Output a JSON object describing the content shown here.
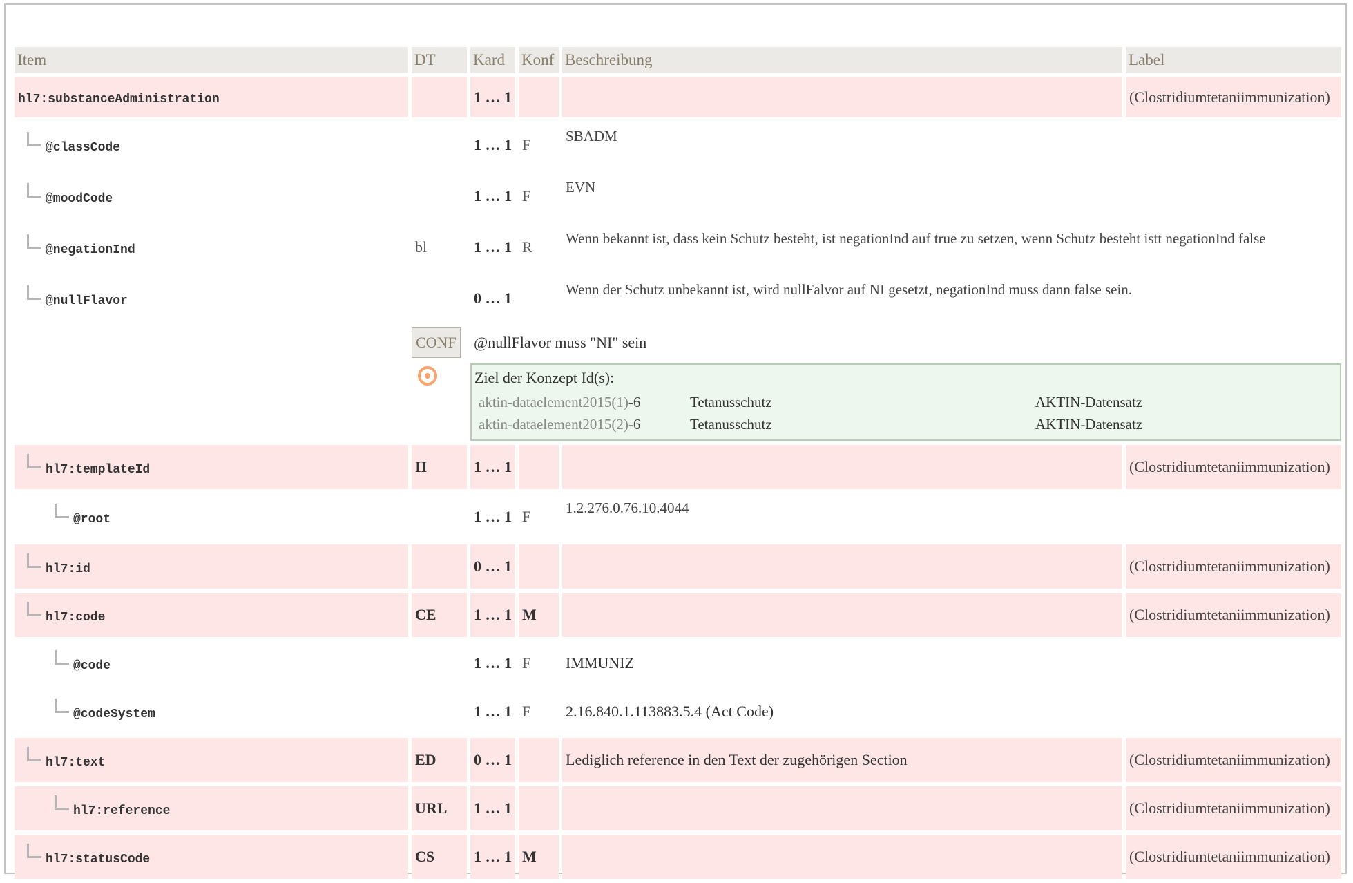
{
  "headers": {
    "item": "Item",
    "dt": "DT",
    "kard": "Kard",
    "konf": "Konf",
    "beschreibung": "Beschreibung",
    "label": "Label"
  },
  "rows": [
    {
      "item": "hl7:substanceAdministration",
      "dt": "",
      "kard": "1 … 1",
      "konf": "",
      "desc": "",
      "label": "(Clostridiumtetaniimmunization)"
    },
    {
      "item": "@classCode",
      "dt": "",
      "kard": "1 … 1",
      "konf": "F",
      "desc": "SBADM",
      "label": ""
    },
    {
      "item": "@moodCode",
      "dt": "",
      "kard": "1 … 1",
      "konf": "F",
      "desc": "EVN",
      "label": ""
    },
    {
      "item": "@negationInd",
      "dt": "bl",
      "kard": "1 … 1",
      "konf": "R",
      "desc": "Wenn bekannt ist, dass kein Schutz besteht, ist negationInd auf true zu setzen, wenn Schutz besteht istt negationInd false",
      "label": ""
    },
    {
      "item": "@nullFlavor",
      "dt": "",
      "kard": "0 … 1",
      "konf": "",
      "desc": "Wenn der Schutz unbekannt ist, wird nullFalvor auf NI gesetzt, negationInd muss dann false sein.",
      "label": ""
    },
    {
      "item": "hl7:templateId",
      "dt": "II",
      "kard": "1 … 1",
      "konf": "",
      "desc": "",
      "label": "(Clostridiumtetaniimmunization)"
    },
    {
      "item": "@root",
      "dt": "",
      "kard": "1 … 1",
      "konf": "F",
      "desc": "1.2.276.0.76.10.4044",
      "label": ""
    },
    {
      "item": "hl7:id",
      "dt": "",
      "kard": "0 … 1",
      "konf": "",
      "desc": "",
      "label": "(Clostridiumtetaniimmunization)"
    },
    {
      "item": "hl7:code",
      "dt": "CE",
      "kard": "1 … 1",
      "konf": "M",
      "desc": "",
      "label": "(Clostridiumtetaniimmunization)"
    },
    {
      "item": "@code",
      "dt": "",
      "kard": "1 … 1",
      "konf": "F",
      "desc": "IMMUNIZ",
      "label": ""
    },
    {
      "item": "@codeSystem",
      "dt": "",
      "kard": "1 … 1",
      "konf": "F",
      "desc": "2.16.840.1.113883.5.4 (Act Code)",
      "label": ""
    },
    {
      "item": "hl7:text",
      "dt": "ED",
      "kard": "0 … 1",
      "konf": "",
      "desc": "Lediglich reference in den Text der zugehörigen Section",
      "label": "(Clostridiumtetaniimmunization)"
    },
    {
      "item": "hl7:reference",
      "dt": "URL",
      "kard": "1 … 1",
      "konf": "",
      "desc": "",
      "label": "(Clostridiumtetaniimmunization)"
    },
    {
      "item": "hl7:statusCode",
      "dt": "CS",
      "kard": "1 … 1",
      "konf": "M",
      "desc": "",
      "label": "(Clostridiumtetaniimmunization)"
    }
  ],
  "conf": {
    "badge": "CONF",
    "text": "@nullFlavor muss \"NI\" sein"
  },
  "concept": {
    "title": "Ziel der Konzept Id(s):",
    "items": [
      {
        "id": "aktin-dataelement2015(1)",
        "suffix": "-6",
        "name": "Tetanusschutz",
        "set": "AKTIN-Datensatz"
      },
      {
        "id": "aktin-dataelement2015(2)",
        "suffix": "-6",
        "name": "Tetanusschutz",
        "set": "AKTIN-Datensatz"
      }
    ]
  },
  "icons": {
    "target": "target-icon",
    "tree": "tree-connector-icon"
  },
  "colors": {
    "header_bg": "#eceae6",
    "row_pink": "#fee6e7",
    "concept_bg": "#edf7ee",
    "icon": "#f6a36d"
  }
}
